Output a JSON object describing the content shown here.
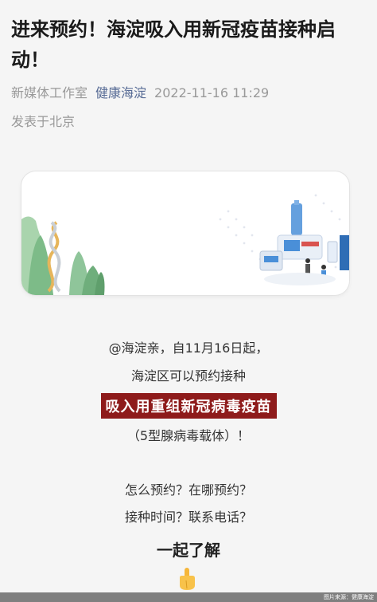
{
  "article": {
    "title": "进来预约！海淀吸入用新冠疫苗接种启动！",
    "author": "新媒体工作室",
    "account": "健康海淀",
    "datetime": "2022-11-16 11:29",
    "location": "发表于北京"
  },
  "content": {
    "line1": "@海淀亲，自11月16日起，",
    "line2": "海淀区可以预约接种",
    "highlight": "吸入用重组新冠病毒疫苗",
    "line3": "（5型腺病毒载体）！",
    "line4": "怎么预约？在哪预约？",
    "line5": "接种时间？联系电话？",
    "line6": "一起了解"
  },
  "footer": {
    "source": "图片来源：健康海淀"
  },
  "colors": {
    "accent_link": "#576b95",
    "highlight_bg": "#8e1b1b",
    "banner_green": "#8fc59a",
    "banner_blue": "#4a8fd8"
  }
}
